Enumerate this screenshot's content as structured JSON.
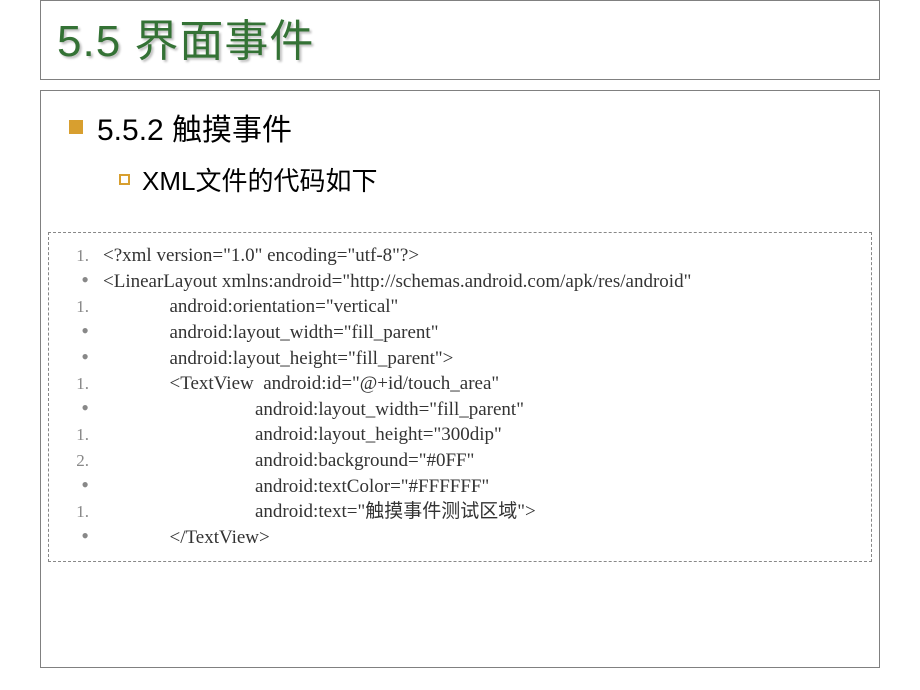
{
  "title": "5.5  界面事件",
  "subheading": "5.5.2 触摸事件",
  "sub2": "XML文件的代码如下",
  "code": [
    {
      "marker": "1.",
      "text": "<?xml version=\"1.0\" encoding=\"utf-8\"?>"
    },
    {
      "marker": "•",
      "text": "<LinearLayout xmlns:android=\"http://schemas.android.com/apk/res/android\""
    },
    {
      "marker": "1.",
      "text": "              android:orientation=\"vertical\""
    },
    {
      "marker": "•",
      "text": "              android:layout_width=\"fill_parent\""
    },
    {
      "marker": "•",
      "text": "              android:layout_height=\"fill_parent\">"
    },
    {
      "marker": "1.",
      "text": "              <TextView  android:id=\"@+id/touch_area\""
    },
    {
      "marker": "•",
      "text": "                                android:layout_width=\"fill_parent\" "
    },
    {
      "marker": "1.",
      "text": "                                android:layout_height=\"300dip\""
    },
    {
      "marker": "2.",
      "text": "                                android:background=\"#0FF\""
    },
    {
      "marker": "•",
      "text": "                                android:textColor=\"#FFFFFF\""
    },
    {
      "marker": "1.",
      "text": "                                android:text=\"触摸事件测试区域\">"
    },
    {
      "marker": "•",
      "text": "              </TextView>"
    }
  ]
}
